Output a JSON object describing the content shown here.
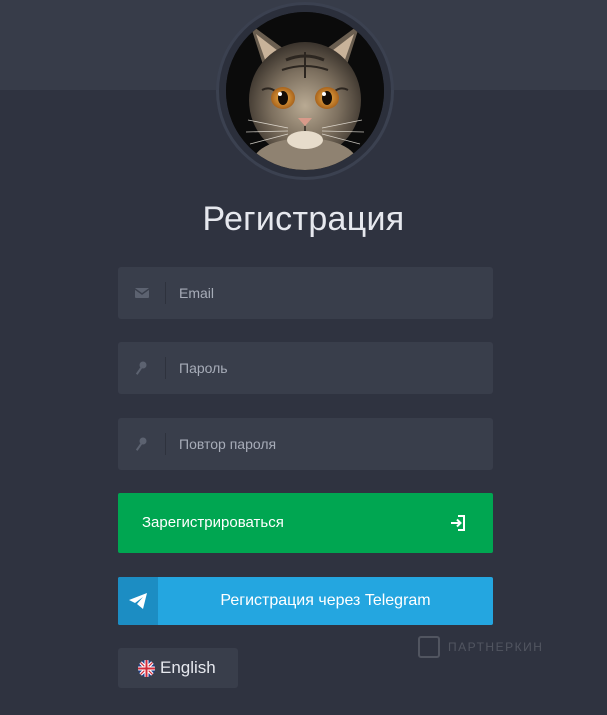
{
  "page": {
    "title": "Регистрация",
    "avatar_alt": "cat avatar"
  },
  "form": {
    "email": {
      "placeholder": "Email",
      "value": "",
      "icon": "envelope-icon"
    },
    "password": {
      "placeholder": "Пароль",
      "value": "",
      "icon": "key-icon"
    },
    "password_repeat": {
      "placeholder": "Повтор пароля",
      "value": "",
      "icon": "key-icon"
    }
  },
  "buttons": {
    "register": {
      "label": "Зарегистрироваться",
      "icon": "sign-in-icon",
      "color": "#00a651"
    },
    "telegram": {
      "label": "Регистрация через Telegram",
      "icon": "paper-plane-icon",
      "color": "#24a6e0"
    }
  },
  "language": {
    "label": "English",
    "icon": "uk-flag-icon"
  },
  "watermark": {
    "text": "ПАРТНЕРКИН"
  },
  "colors": {
    "background": "#2f3340",
    "top_band": "#373c49",
    "field": "#393e4b"
  }
}
